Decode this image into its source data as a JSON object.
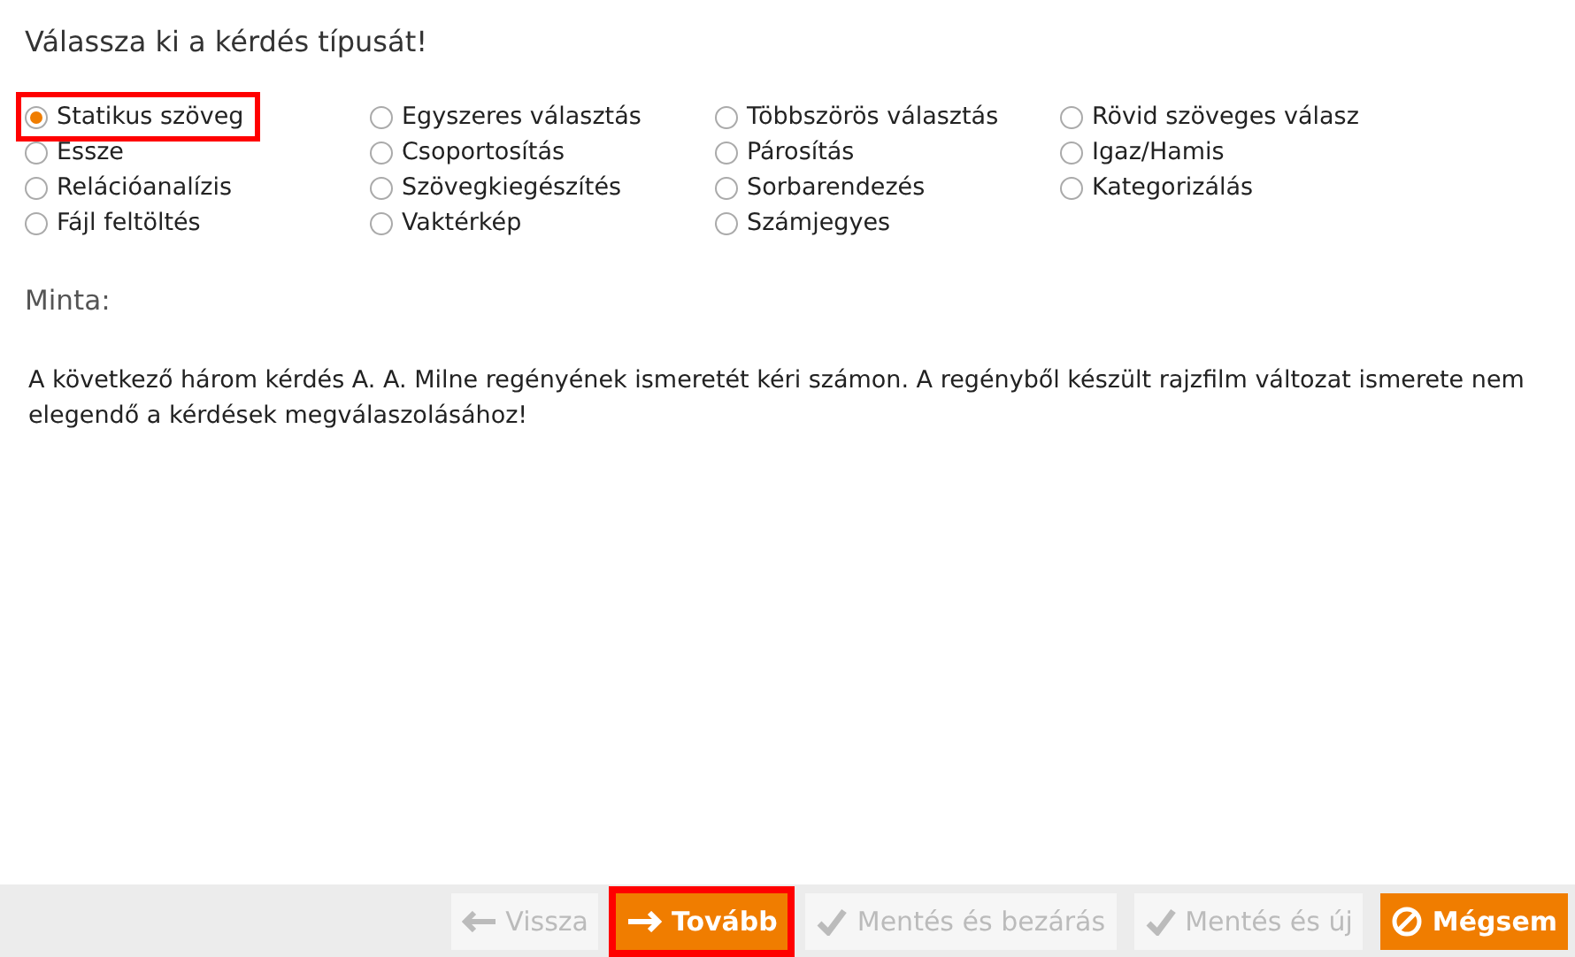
{
  "heading": "Válassza ki a kérdés típusát!",
  "question_types": [
    {
      "label": "Statikus szöveg",
      "selected": true,
      "highlighted": true
    },
    {
      "label": "Egyszeres választás",
      "selected": false,
      "highlighted": false
    },
    {
      "label": "Többszörös választás",
      "selected": false,
      "highlighted": false
    },
    {
      "label": "Rövid szöveges válasz",
      "selected": false,
      "highlighted": false
    },
    {
      "label": "Essze",
      "selected": false,
      "highlighted": false
    },
    {
      "label": "Csoportosítás",
      "selected": false,
      "highlighted": false
    },
    {
      "label": "Párosítás",
      "selected": false,
      "highlighted": false
    },
    {
      "label": "Igaz/Hamis",
      "selected": false,
      "highlighted": false
    },
    {
      "label": "Relációanalízis",
      "selected": false,
      "highlighted": false
    },
    {
      "label": "Szövegkiegészítés",
      "selected": false,
      "highlighted": false
    },
    {
      "label": "Sorbarendezés",
      "selected": false,
      "highlighted": false
    },
    {
      "label": "Kategorizálás",
      "selected": false,
      "highlighted": false
    },
    {
      "label": "Fájl feltöltés",
      "selected": false,
      "highlighted": false
    },
    {
      "label": "Vaktérkép",
      "selected": false,
      "highlighted": false
    },
    {
      "label": "Számjegyes",
      "selected": false,
      "highlighted": false
    }
  ],
  "sample": {
    "title": "Minta:",
    "text": "A következő három kérdés A. A. Milne regényének ismeretét kéri számon. A regényből készült rajzfilm változat ismerete nem elegendő a kérdések megválaszolásához!"
  },
  "buttons": [
    {
      "kind": "back",
      "label": "Vissza",
      "disabled": true,
      "highlighted": false
    },
    {
      "kind": "next",
      "label": "Tovább",
      "disabled": false,
      "highlighted": true
    },
    {
      "kind": "save",
      "label": "Mentés és bezárás",
      "disabled": true,
      "highlighted": false
    },
    {
      "kind": "save",
      "label": "Mentés és új",
      "disabled": true,
      "highlighted": false
    },
    {
      "kind": "cancel",
      "label": "Mégsem",
      "disabled": false,
      "highlighted": false
    }
  ]
}
